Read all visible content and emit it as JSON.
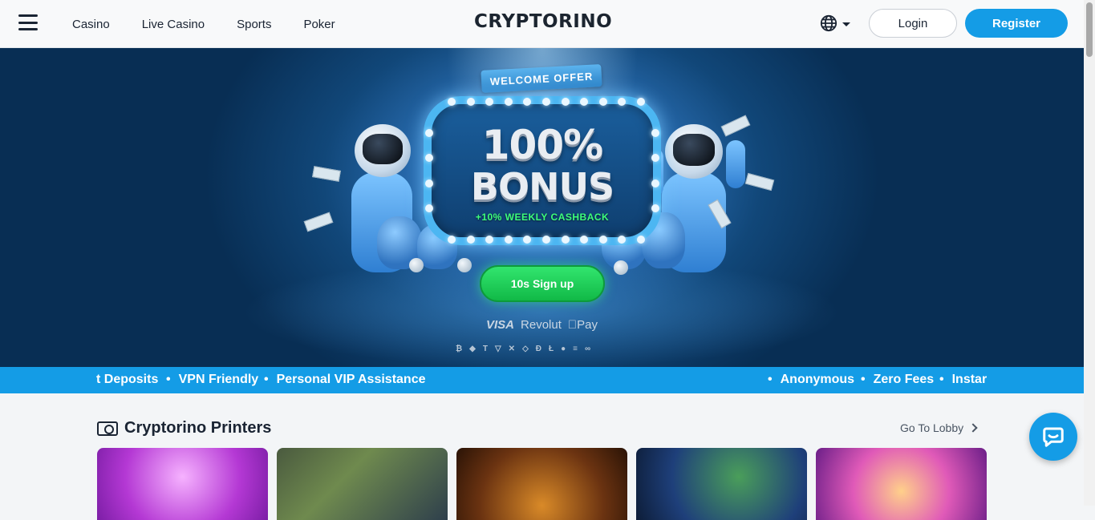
{
  "header": {
    "nav": [
      "Casino",
      "Live Casino",
      "Sports",
      "Poker"
    ],
    "logo": "CRYPTORINO",
    "login_label": "Login",
    "register_label": "Register",
    "language_icon": "globe-icon"
  },
  "hero": {
    "ribbon": "WELCOME OFFER",
    "bonus_percent": "100%",
    "bonus_word": "BONUS",
    "cashback": "+10% WEEKLY CASHBACK",
    "cta_label": "10s Sign up",
    "payments": [
      "VISA",
      "Revolut",
      "Pay"
    ],
    "crypto_icons": [
      "bitcoin-icon",
      "ethereum-icon",
      "tether-icon",
      "tron-icon",
      "xrp-icon",
      "binance-icon",
      "dogecoin-icon",
      "litecoin-icon",
      "shiba-icon",
      "solana-icon",
      "chainlink-icon"
    ],
    "colors": {
      "accent": "#149ce6",
      "cta": "#1fcf56",
      "cashback": "#3dff7a"
    }
  },
  "ticker": {
    "left_items": [
      "t Deposits",
      "VPN Friendly",
      "Personal VIP Assistance"
    ],
    "right_items": [
      "Anonymous",
      "Zero Fees",
      "Instar"
    ]
  },
  "section": {
    "title": "Cryptorino Printers",
    "lobby_label": "Go To Lobby"
  }
}
